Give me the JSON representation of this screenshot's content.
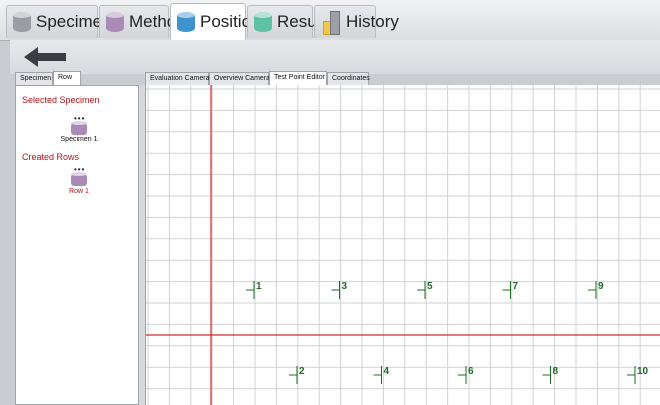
{
  "main_tabs": [
    {
      "label": "Specimen",
      "icon": "gray-cylinder-icon",
      "color": "#9a9da2"
    },
    {
      "label": "Method",
      "icon": "purple-cylinder-icon",
      "color": "#a98bb5"
    },
    {
      "label": "Position",
      "icon": "blue-cylinder-icon",
      "color": "#3e93cf",
      "active": true
    },
    {
      "label": "Result",
      "icon": "green-cylinder-icon",
      "color": "#5ec1a4"
    },
    {
      "label": "History",
      "icon": "history-icon"
    }
  ],
  "toolbar": {
    "back_icon": "back-arrow-icon"
  },
  "left_tabs": [
    {
      "label": "Specimen"
    },
    {
      "label": "Row",
      "active": true
    }
  ],
  "left_panel": {
    "selected_title": "Selected Specimen",
    "selected_item": {
      "dots": "•••",
      "label": "Specimen 1"
    },
    "created_title": "Created Rows",
    "created_item": {
      "dots": "•••",
      "label": "Row 1"
    }
  },
  "editor_tabs": [
    {
      "label": "Evaluation Camera"
    },
    {
      "label": "Overview Camera"
    },
    {
      "label": "Test Point Editor",
      "active": true
    },
    {
      "label": "Coordinates"
    }
  ],
  "test_points": [
    "1",
    "3",
    "5",
    "7",
    "9",
    "2",
    "4",
    "6",
    "8",
    "10"
  ],
  "colors": {
    "accent_red": "#b0141a",
    "axis_red": "#d42b2b",
    "grid": "#cfd2d6",
    "point_green": "#1f6b25"
  }
}
